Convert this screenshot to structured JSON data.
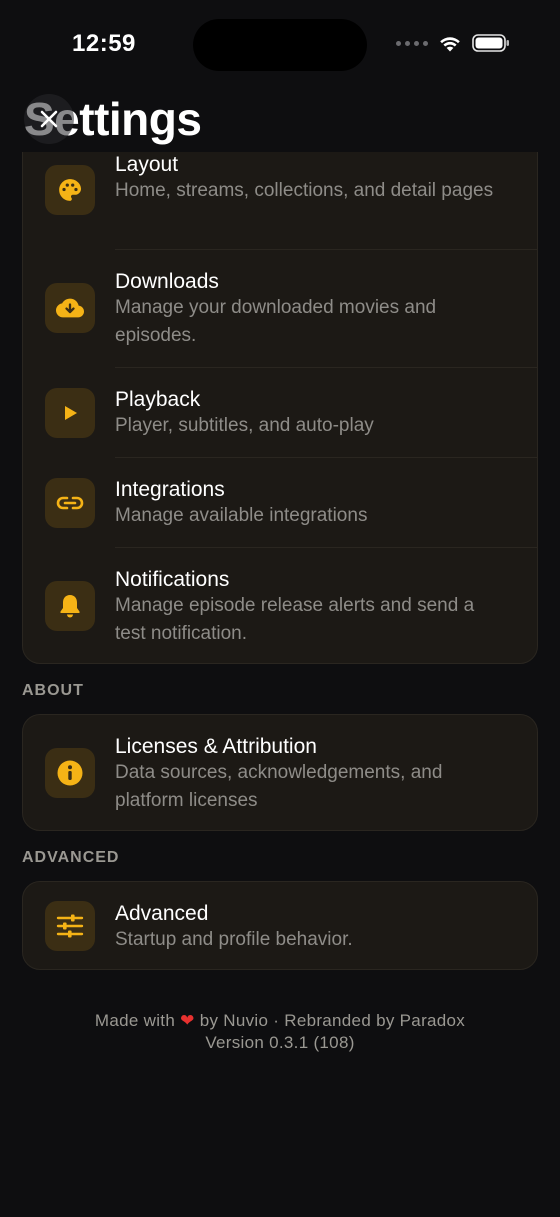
{
  "status_bar": {
    "time": "12:59"
  },
  "header": {
    "title": "Settings"
  },
  "main_list": {
    "items": [
      {
        "title": "Layout",
        "subtitle": "Home, streams, collections, and detail pages",
        "icon": "palette-icon"
      },
      {
        "title": "Downloads",
        "subtitle": "Manage your downloaded movies and episodes.",
        "icon": "cloud-download-icon"
      },
      {
        "title": "Playback",
        "subtitle": "Player, subtitles, and auto-play",
        "icon": "play-icon"
      },
      {
        "title": "Integrations",
        "subtitle": "Manage available integrations",
        "icon": "link-icon"
      },
      {
        "title": "Notifications",
        "subtitle": "Manage episode release alerts and send a test notification.",
        "icon": "bell-icon"
      }
    ]
  },
  "about": {
    "label": "ABOUT",
    "items": [
      {
        "title": "Licenses & Attribution",
        "subtitle": "Data sources, acknowledgements, and platform licenses",
        "icon": "info-icon"
      }
    ]
  },
  "advanced": {
    "label": "ADVANCED",
    "items": [
      {
        "title": "Advanced",
        "subtitle": "Startup and profile behavior.",
        "icon": "sliders-icon"
      }
    ]
  },
  "footer": {
    "made_with_prefix": "Made with",
    "made_with_suffix": "by Nuvio · Rebranded by Paradox",
    "version": "Version 0.3.1 (108)"
  },
  "colors": {
    "background": "#0e0e10",
    "card": "#1c1915",
    "accent": "#f5b316",
    "icon_bg": "#3b2e14",
    "heart": "#e8312f"
  }
}
